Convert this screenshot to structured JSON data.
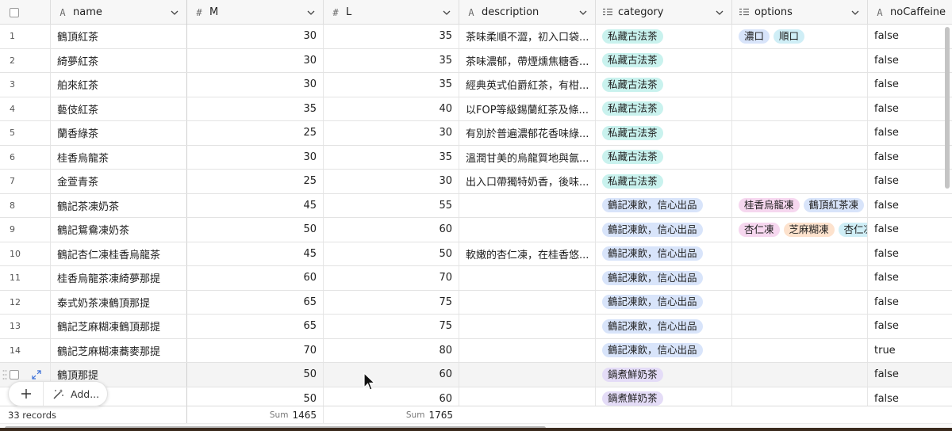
{
  "columns": {
    "name": {
      "label": "name",
      "type_icon": "A"
    },
    "m": {
      "label": "M",
      "type_icon": "#"
    },
    "l": {
      "label": "L",
      "type_icon": "#"
    },
    "description": {
      "label": "description",
      "type_icon": "A"
    },
    "category": {
      "label": "category",
      "type_icon": "multi-select-icon"
    },
    "options": {
      "label": "options",
      "type_icon": "multi-select-icon"
    },
    "nocaffeine": {
      "label": "noCaffeine",
      "type_icon": "A"
    }
  },
  "rows": [
    {
      "num": "1",
      "name": "鶴頂紅茶",
      "m": "30",
      "l": "35",
      "description": "茶味柔順不澀，初入口袋...",
      "category": "私藏古法茶",
      "options": [
        "濃口",
        "順口"
      ],
      "nocaffeine": "false"
    },
    {
      "num": "2",
      "name": "綺夢紅茶",
      "m": "30",
      "l": "35",
      "description": "茶味濃郁，帶煙燻焦糖香...",
      "category": "私藏古法茶",
      "options": [],
      "nocaffeine": "false"
    },
    {
      "num": "3",
      "name": "舶來紅茶",
      "m": "30",
      "l": "35",
      "description": "經典英式伯爵紅茶，有柑...",
      "category": "私藏古法茶",
      "options": [],
      "nocaffeine": "false"
    },
    {
      "num": "4",
      "name": "藝伎紅茶",
      "m": "35",
      "l": "40",
      "description": "以FOP等級錫蘭紅茶及條...",
      "category": "私藏古法茶",
      "options": [],
      "nocaffeine": "false"
    },
    {
      "num": "5",
      "name": "蘭香綠茶",
      "m": "25",
      "l": "30",
      "description": "有別於普遍濃郁花香味綠...",
      "category": "私藏古法茶",
      "options": [],
      "nocaffeine": "false"
    },
    {
      "num": "6",
      "name": "桂香烏龍茶",
      "m": "30",
      "l": "35",
      "description": "溫潤甘美的烏龍質地與氤...",
      "category": "私藏古法茶",
      "options": [],
      "nocaffeine": "false"
    },
    {
      "num": "7",
      "name": "金萱青茶",
      "m": "25",
      "l": "30",
      "description": "出入口帶獨特奶香，後味...",
      "category": "私藏古法茶",
      "options": [],
      "nocaffeine": "false"
    },
    {
      "num": "8",
      "name": "鶴記茶凍奶茶",
      "m": "45",
      "l": "55",
      "description": "",
      "category": "鶴記凍飲，信心出品",
      "options": [
        "桂香烏龍凍",
        "鶴頂紅茶凍"
      ],
      "nocaffeine": "false"
    },
    {
      "num": "9",
      "name": "鶴記鴛鴦凍奶茶",
      "m": "50",
      "l": "60",
      "description": "",
      "category": "鶴記凍飲，信心出品",
      "options": [
        "杏仁凍",
        "芝麻糊凍",
        "杏仁凍"
      ],
      "nocaffeine": "false"
    },
    {
      "num": "10",
      "name": "鶴記杏仁凍桂香烏龍茶",
      "m": "45",
      "l": "50",
      "description": "軟嫩的杏仁凍，在桂香悠...",
      "category": "鶴記凍飲，信心出品",
      "options": [],
      "nocaffeine": "false"
    },
    {
      "num": "11",
      "name": "桂香烏龍茶凍綺夢那提",
      "m": "60",
      "l": "70",
      "description": "",
      "category": "鶴記凍飲，信心出品",
      "options": [],
      "nocaffeine": "false"
    },
    {
      "num": "12",
      "name": "泰式奶茶凍鶴頂那提",
      "m": "65",
      "l": "75",
      "description": "",
      "category": "鶴記凍飲，信心出品",
      "options": [],
      "nocaffeine": "false"
    },
    {
      "num": "13",
      "name": "鶴記芝麻糊凍鶴頂那提",
      "m": "65",
      "l": "75",
      "description": "",
      "category": "鶴記凍飲，信心出品",
      "options": [],
      "nocaffeine": "false"
    },
    {
      "num": "14",
      "name": "鶴記芝麻糊凍蕎麥那提",
      "m": "70",
      "l": "80",
      "description": "",
      "category": "鶴記凍飲，信心出品",
      "options": [],
      "nocaffeine": "true"
    },
    {
      "num": "",
      "name": "鶴頂那提",
      "m": "50",
      "l": "60",
      "description": "",
      "category": "鍋煮鮮奶茶",
      "options": [],
      "nocaffeine": "false"
    },
    {
      "num": "",
      "name": "",
      "m": "50",
      "l": "60",
      "description": "",
      "category": "鍋煮鮮奶茶",
      "options": [],
      "nocaffeine": "false"
    }
  ],
  "category_colors": {
    "私藏古法茶": "#c9f2ee",
    "鶴記凍飲，信心出品": "#d8e4fa",
    "鍋煮鮮奶茶": "#e4dcf7"
  },
  "option_colors": {
    "濃口": "#d8e4fa",
    "順口": "#cfeef6",
    "桂香烏龍凍": "#f6d7ef",
    "鶴頂紅茶凍": "#d8e4fa",
    "杏仁凍": "#f6d7ef",
    "芝麻糊凍": "#fde2cd"
  },
  "footer": {
    "records": "33 records",
    "sum_label": "Sum",
    "sum_m": "1465",
    "sum_l": "1765"
  },
  "add_button": {
    "label": "Add..."
  }
}
